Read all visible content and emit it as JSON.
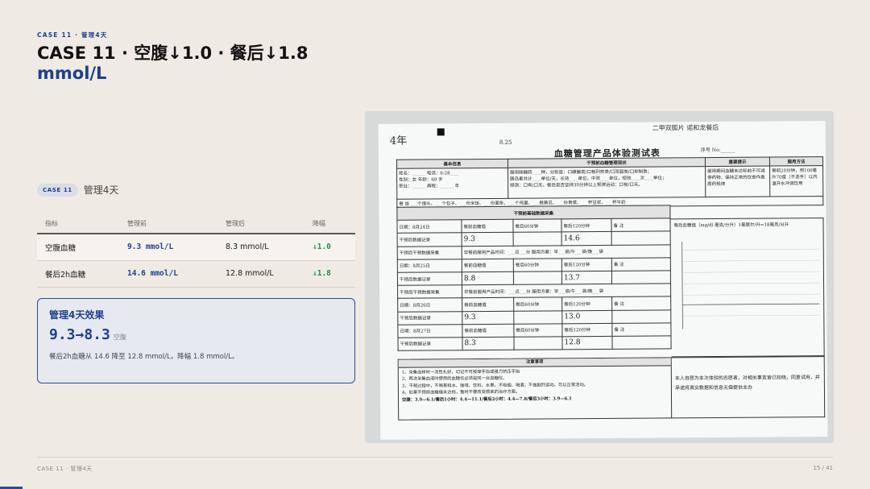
{
  "header": {
    "eyebrow": "CASE 11 · 管理4天",
    "title_line1": "CASE 11 · 空腹↓1.0 · 餐后↓1.8",
    "title_line2": "mmol/L"
  },
  "badge": {
    "tag": "CASE 11",
    "label": "管理4天"
  },
  "table": {
    "headers": [
      "指标",
      "管理前",
      "管理后",
      "降幅"
    ],
    "rows": [
      {
        "name": "空腹血糖",
        "before": "9.3 mmol/L",
        "after": "8.3 mmol/L",
        "drop": "↓1.0"
      },
      {
        "name": "餐后2h血糖",
        "before": "14.6 mmol/L",
        "after": "12.8 mmol/L",
        "drop": "↓1.8"
      }
    ]
  },
  "card": {
    "title": "管理4天效果",
    "big": "9.3→8.3",
    "big_unit": "空腹",
    "desc": "餐后2h血糖从 14.6 降至 12.8 mmol/L，降幅 1.8 mmol/L。"
  },
  "photo": {
    "form_title": "血糖管理产品体验测试表",
    "hand_top_left": "4年",
    "hand_date": "8.25",
    "hand_top_right": "二甲双胍片 诺和龙餐后",
    "serial_label": "序号 No:______",
    "head_cells": [
      "基本信息",
      "干预前血糖管理现状",
      "重要提示",
      "服用方法"
    ],
    "basic_info": "姓名：______  电话：6:28____\n性别：女  年龄：69 岁\n职业：______  病程：______ 年",
    "status_info": "服用降糖药____种，分别是：口磺脲类/口格列奈类/口双胍类/口抑制类；\n胰岛素共计____单位/天，长效____单位，中效____单位，短效____次____单位；\n频测：口有/口无，餐后是否坚持30分钟以上规律运动：口有/口无。",
    "tips": "服用期间血糖未达标前不可减停药物，保持正常的饮食作息原药规律",
    "method": "餐前20分钟，用100毫升70度（不烫手）以内温开水冲调饮用",
    "diet_row": "餐 饭  ___个馒头、___个包子、___份米饭、___份面条、___个鸡蛋、___根黄瓜、___份青菜、___杯豆浆、___杯牛奶",
    "section_header": "干预前基础数据采集",
    "day_rows": [
      {
        "date": "日期：8月24日",
        "fasting": "9.3",
        "post": "14.6"
      },
      {
        "date": "日期：8月25日",
        "fasting": "8.8",
        "post": "13.7"
      },
      {
        "date": "日期：8月26日",
        "fasting": "9.3",
        "post": "13.0"
      },
      {
        "date": "日期：8月27日",
        "fasting": "8.3",
        "post": "12.8"
      }
    ],
    "col_fasting": "餐前血糖值",
    "col_60": "餐后60分钟",
    "col_120": "餐后120分钟",
    "col_note": "备  注",
    "record_label": "干预后数据记录",
    "sample_label": "干预后干预数据采集",
    "sample_value": "早餐前服用产品时间：___点___分   服用方案：早___袋/午___袋/晚___袋",
    "chart_caption": "餐后血糖值（mg/dl 毫克/分升）1毫摩尔/升=18毫克/分升",
    "notes_header": "注意事项",
    "notes": [
      "1、采集血样时一次性扎好，切记不可按摩手指或强力挤压手指",
      "2、两次采集血液时使用的血糖仪必须是同一台血糖仪。",
      "3、干预过程中，不喝茶和水、咖啡、饮料、水果、不吸烟、喝酒；不做剧烈运动，可以正常活动。",
      "4、如果干预前血糖值未达标，暂时不要改变原来的治疗方案。"
    ],
    "notes_footer": "空腹：3.9—6.1/餐后1小时：4.4—11.1/餐后2小时：4.4—7.8/餐后3小时：3.9—6.1",
    "consent": "本人自愿为本次体验的志愿者，对相关事宜皆已知晓，同意试用，并承诺将真实数据和信息无偿提供主办"
  },
  "footer": {
    "left": "CASE 11 · 管理4天",
    "right": "15 / 41"
  },
  "colors": {
    "accent": "#1f3f8f",
    "drop": "#2b8a4a",
    "bg": "#efebe4"
  }
}
